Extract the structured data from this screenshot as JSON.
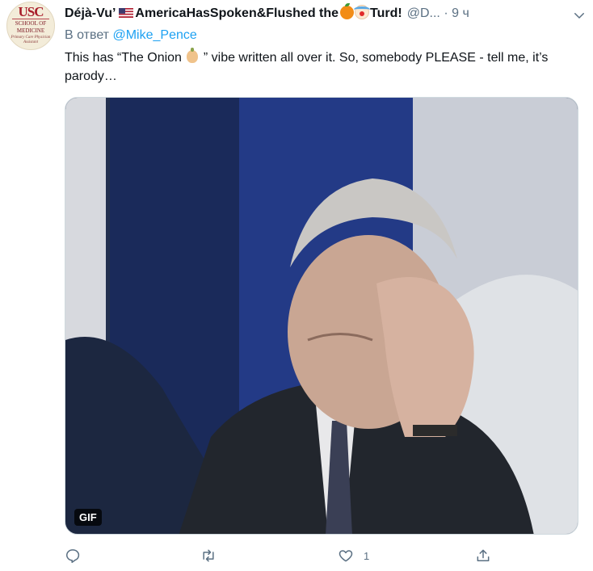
{
  "tweet": {
    "avatar": {
      "logo_text": "USC",
      "line1": "SCHOOL OF",
      "line2": "MEDICINE",
      "line3": "Primary Care Physician Assistant"
    },
    "author_name_part1": "Déjà-Vu’",
    "author_name_part2": "AmericaHasSpoken&Flushed the",
    "author_name_part3": "Turd!",
    "handle": "@D...",
    "separator": "·",
    "time": "9 ч",
    "reply_prefix": "В ответ",
    "reply_mention": "@Mike_Pence",
    "text_part1": "This has “The Onion",
    "text_part2": "” vibe written all over it. So, somebody PLEASE - tell me, it’s parody…",
    "media_badge": "GIF",
    "actions": {
      "reply_count": "",
      "retweet_count": "",
      "like_count": "1",
      "share_count": ""
    }
  }
}
